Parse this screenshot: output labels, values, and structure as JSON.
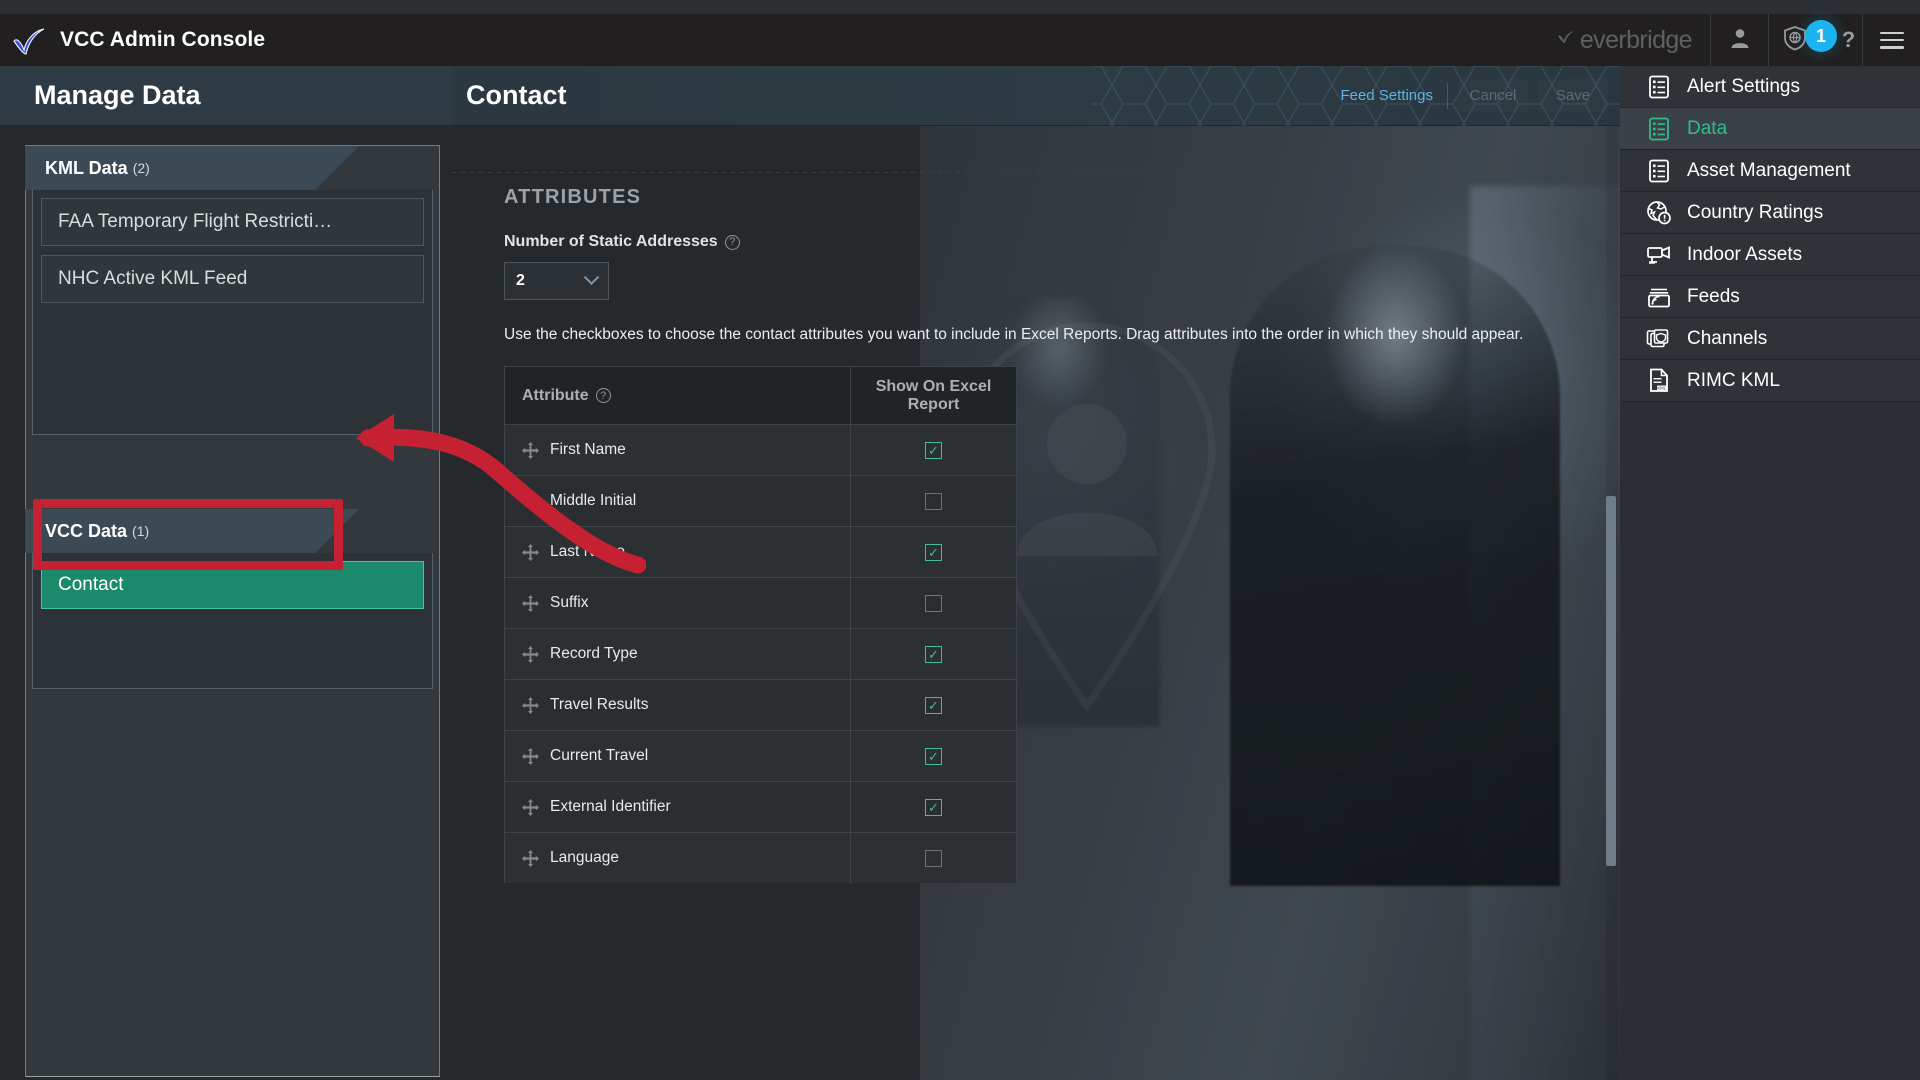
{
  "topbar": {
    "logo_icon": "everbridge-check-logo",
    "app_title": "VCC Admin Console",
    "brand_text": "everbridge",
    "user_icon": "user-icon",
    "shield_icon": "shield-globe-icon",
    "notification_count": "1",
    "help_icon": "question-mark-icon",
    "help_label": "?",
    "menu_icon": "hamburger-menu-icon"
  },
  "left_panel": {
    "title": "Manage Data",
    "groups": [
      {
        "label": "KML Data",
        "count": "(2)",
        "items": [
          {
            "label": "FAA Temporary Flight Restricti…",
            "selected": false
          },
          {
            "label": "NHC Active KML Feed",
            "selected": false
          }
        ]
      },
      {
        "label": "VCC Data",
        "count": "(1)",
        "items": [
          {
            "label": "Contact",
            "selected": true
          }
        ]
      }
    ]
  },
  "main": {
    "title": "Contact",
    "feed_settings_label": "Feed Settings",
    "cancel_label": "Cancel",
    "save_label": "Save",
    "section_title": "ATTRIBUTES",
    "static_addresses_label": "Number of Static Addresses",
    "static_addresses_value": "2",
    "static_addresses_help": "?",
    "instructions": "Use the checkboxes to choose the contact attributes you want to include in Excel Reports. Drag attributes into the order in which they should appear.",
    "table": {
      "col_attribute": "Attribute",
      "col_attribute_help": "?",
      "col_show": "Show On Excel Report",
      "rows": [
        {
          "attribute": "First Name",
          "checked": true
        },
        {
          "attribute": "Middle Initial",
          "checked": false
        },
        {
          "attribute": "Last Name",
          "checked": true
        },
        {
          "attribute": "Suffix",
          "checked": false
        },
        {
          "attribute": "Record Type",
          "checked": true
        },
        {
          "attribute": "Travel Results",
          "checked": true
        },
        {
          "attribute": "Current Travel",
          "checked": true
        },
        {
          "attribute": "External Identifier",
          "checked": true
        },
        {
          "attribute": "Language",
          "checked": false
        }
      ]
    }
  },
  "right_nav": {
    "items": [
      {
        "label": "Alert Settings",
        "icon": "list-document-icon",
        "active": false
      },
      {
        "label": "Data",
        "icon": "list-document-icon",
        "active": true
      },
      {
        "label": "Asset Management",
        "icon": "list-document-icon",
        "active": false
      },
      {
        "label": "Country Ratings",
        "icon": "globe-alert-icon",
        "active": false
      },
      {
        "label": "Indoor Assets",
        "icon": "camera-icon",
        "active": false
      },
      {
        "label": "Feeds",
        "icon": "feed-box-icon",
        "active": false
      },
      {
        "label": "Channels",
        "icon": "channels-stack-icon",
        "active": false
      },
      {
        "label": "RIMC KML",
        "icon": "kml-document-icon",
        "active": false
      }
    ]
  },
  "annotation": {
    "highlight_color": "#c62033",
    "shape": "red-rectangle-and-arrow-pointing-to-contact"
  },
  "colors": {
    "accent_green": "#1b8a6b",
    "accent_blue": "#1cb4ee",
    "link_blue": "#61b6e0",
    "nav_active_text": "#2fbd8a"
  }
}
